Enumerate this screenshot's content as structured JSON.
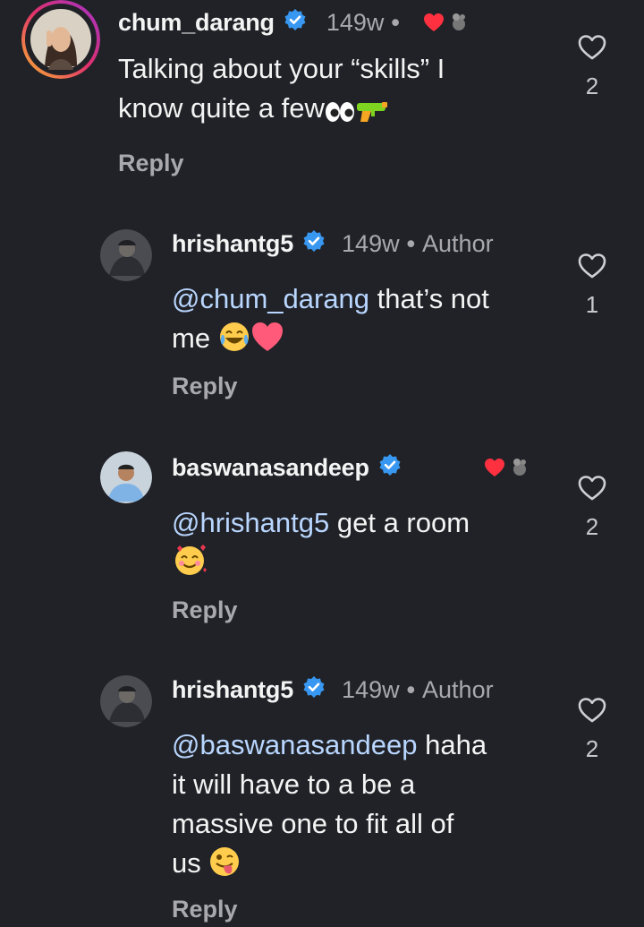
{
  "comments": [
    {
      "username": "chum_darang",
      "time": "149w",
      "author_label": "",
      "mention": "",
      "text_line1": "Talking about your “skills” I",
      "text_line2": "know quite a few",
      "reply": "Reply",
      "likes": "2",
      "emojis": [
        "eyes-emoji",
        "water-pistol-emoji"
      ]
    },
    {
      "username": "hrishantg5",
      "time": "149w",
      "author_label": "Author",
      "mention": "@chum_darang",
      "text_line1": " that’s not",
      "text_line2": "me",
      "reply": "Reply",
      "likes": "1",
      "emojis": [
        "tears-of-joy-emoji",
        "heart-emoji"
      ]
    },
    {
      "username": "baswanasandeep",
      "time": "",
      "author_label": "",
      "mention": "@hrishantg5",
      "text_line1": " get a room",
      "text_line2": "",
      "reply": "Reply",
      "likes": "2",
      "emojis": [
        "smiling-face-with-hearts-emoji"
      ]
    },
    {
      "username": "hrishantg5",
      "time": "149w",
      "author_label": "Author",
      "mention": "@baswanasandeep",
      "text_line1": " haha",
      "text_line2": "it will have to a be a",
      "text_line3": "massive one to fit all of",
      "text_line4": "us",
      "reply": "Reply",
      "likes": "2",
      "emojis": [
        "winking-face-with-tongue-emoji"
      ]
    }
  ],
  "icons": {
    "verified": "verified-badge-icon",
    "like": "heart-outline-icon",
    "creator_like": "creator-heart-icon"
  },
  "colors": {
    "background": "#202227",
    "verified_blue": "#3897f0",
    "mention": "#b9d6ff",
    "heart_red": "#ff3040",
    "muted": "#a8a8ad"
  }
}
